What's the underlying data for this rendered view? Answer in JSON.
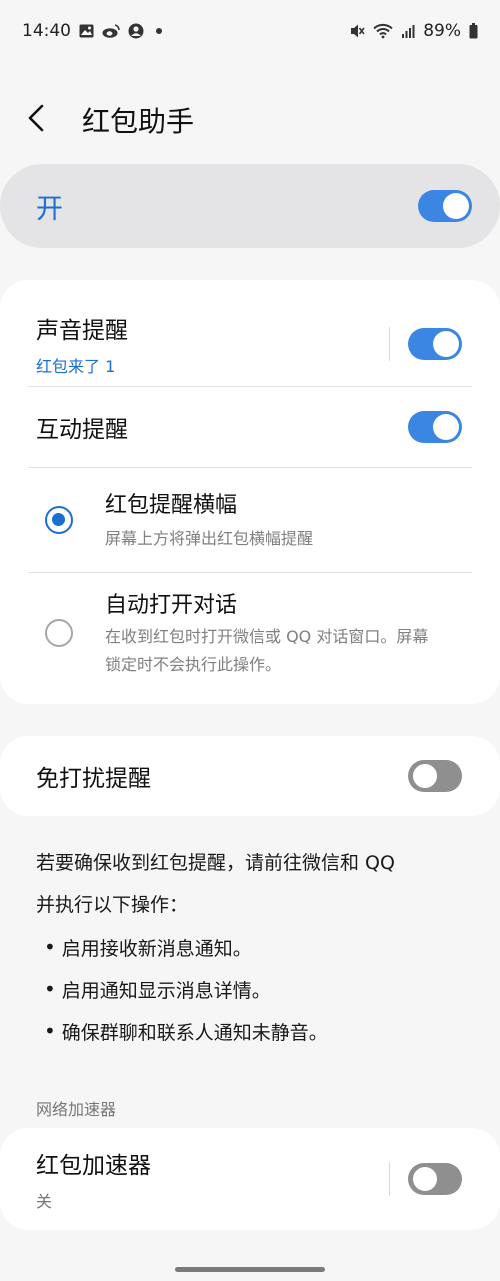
{
  "status": {
    "time": "14:40",
    "battery": "89%",
    "icons_left": [
      "gallery-icon",
      "weibo-icon",
      "account-icon",
      "dot-icon"
    ],
    "icons_right": [
      "mute-icon",
      "wifi-icon",
      "signal-icon",
      "battery-icon"
    ]
  },
  "header": {
    "title": "红包助手"
  },
  "master": {
    "label": "开",
    "enabled": true
  },
  "card1": {
    "sound": {
      "title": "声音提醒",
      "subtitle": "红包来了 1",
      "enabled": true
    },
    "interactive": {
      "title": "互动提醒",
      "enabled": true
    },
    "options": [
      {
        "title": "红包提醒横幅",
        "desc": "屏幕上方将弹出红包横幅提醒",
        "selected": true
      },
      {
        "title": "自动打开对话",
        "desc_line1": "在收到红包时打开微信或 QQ 对话窗口。屏幕",
        "desc_line2": "锁定时不会执行此操作。",
        "selected": false
      }
    ]
  },
  "dnd": {
    "title": "免打扰提醒",
    "enabled": false
  },
  "info": {
    "line1": "若要确保收到红包提醒，请前往微信和 QQ",
    "line2": "并执行以下操作：",
    "bullets": [
      "启用接收新消息通知。",
      "启用通知显示消息详情。",
      "确保群聊和联系人通知未静音。"
    ]
  },
  "network_section": {
    "header": "网络加速器"
  },
  "accelerator": {
    "title": "红包加速器",
    "subtitle": "关",
    "enabled": false
  },
  "colors": {
    "accent": "#1a6fd0",
    "switch_on": "#3a86e2",
    "switch_off": "#8f8f8f"
  }
}
